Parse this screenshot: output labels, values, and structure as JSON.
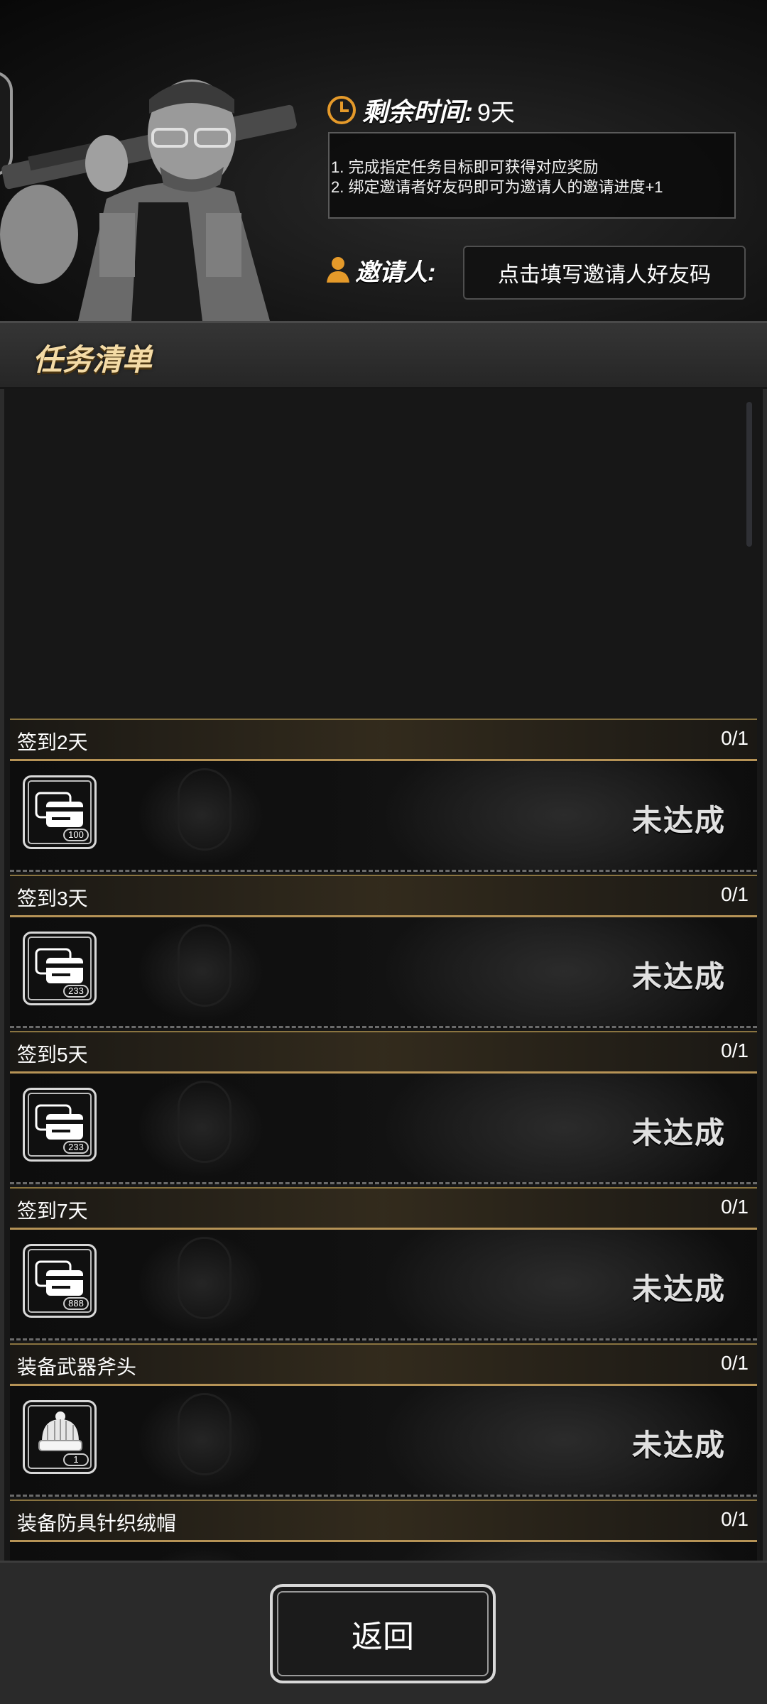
{
  "header": {
    "time_label": "剩余时间:",
    "time_value": "9天",
    "info_lines": [
      "1. 完成指定任务目标即可获得对应奖励",
      "2. 绑定邀请者好友码即可为邀请人的邀请进度+1"
    ],
    "inviter_label": "邀请人:",
    "invite_code_button": "点击填写邀请人好友码"
  },
  "section": {
    "title": "任务清单"
  },
  "tasks": [
    {
      "name": "签到2天",
      "progress": "0/1",
      "reward_icon": "ticket-cards-icon",
      "reward_count": "100",
      "status": "未达成"
    },
    {
      "name": "签到3天",
      "progress": "0/1",
      "reward_icon": "ticket-cards-icon",
      "reward_count": "233",
      "status": "未达成"
    },
    {
      "name": "签到5天",
      "progress": "0/1",
      "reward_icon": "ticket-cards-icon",
      "reward_count": "233",
      "status": "未达成"
    },
    {
      "name": "签到7天",
      "progress": "0/1",
      "reward_icon": "ticket-cards-icon",
      "reward_count": "888",
      "status": "未达成"
    },
    {
      "name": "装备武器斧头",
      "progress": "0/1",
      "reward_icon": "knit-hat-icon",
      "reward_count": "1",
      "status": "未达成"
    },
    {
      "name": "装备防具针织绒帽",
      "progress": "0/1"
    }
  ],
  "footer": {
    "back_button": "返回"
  },
  "colors": {
    "accent_gold": "#b69356",
    "title_gold": "#f4dba6",
    "clock_orange": "#e59a2a"
  }
}
